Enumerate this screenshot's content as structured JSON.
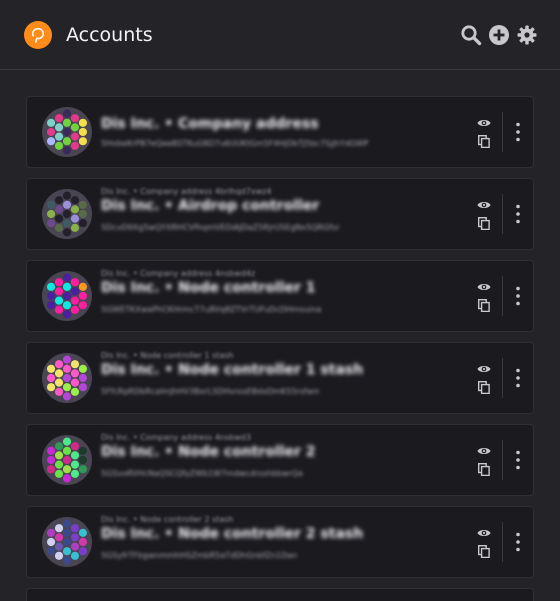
{
  "header": {
    "title": "Accounts",
    "logo_icon": "polkadot-logo",
    "actions": [
      "search-icon",
      "add-account-icon",
      "settings-icon"
    ]
  },
  "accounts": [
    {
      "parent": "",
      "name": "Dis Inc. • Company address",
      "address": "5HxbeKrPB7eQeeBSTKuG8D7u6UUKtGm5F4HjDbTJ5bc7SjjhYdGWP",
      "dots": [
        "#3a2a58",
        "#e23a8a",
        "#e23a8a",
        "#6fd23f",
        "#7fd0c8",
        "#f4df4a",
        "#7fd0c8",
        "#6fd23f",
        "#3a2a58",
        "#e23a8a",
        "#f4df4a",
        "#7fd0c8",
        "#e23a8a",
        "#6fd23f",
        "#a9b8ff",
        "#f4df4a",
        "#6fd23f",
        "#e23a8a",
        "#3a2a58"
      ]
    },
    {
      "parent": "Dis Inc. • Company address 4brlhqd7xwz4",
      "name": "Dis Inc. • Airdrop controller",
      "address": "5DcvD9Xg5wQYXRHCVfhqmVEDiAJDaZ5RjrU5EgNx5QRGfsr",
      "dots": [
        "#23202b",
        "#23202b",
        "#23202b",
        "#9a8fd8",
        "#3f5c64",
        "#5a6a48",
        "#6d4a8c",
        "#8ab04a",
        "#23202b",
        "#8ab04a",
        "#5a6a48",
        "#23202b",
        "#9a8fd8",
        "#3f5c64",
        "#6d4a8c",
        "#23202b",
        "#5a6a48",
        "#8ab04a",
        "#23202b"
      ]
    },
    {
      "parent": "Dis Inc. • Company address 4nsbwd4z",
      "name": "Dis Inc. • Node controller 1",
      "address": "5GWETKXwaPhCKHrmcT7u8Vq8ZTVrTUFuDcDHmsuina",
      "dots": [
        "#4a1fa0",
        "#ff1fa0",
        "#ff1fa0",
        "#13e8e0",
        "#13e8e0",
        "#ff9a1f",
        "#ff1fa0",
        "#4a1fa0",
        "#4a1fa0",
        "#4a1fa0",
        "#ff1fa0",
        "#13e8e0",
        "#ff1fa0",
        "#13e8e0",
        "#4a1fa0",
        "#ff1fa0",
        "#ff1fa0",
        "#ff1fa0",
        "#4a1fa0"
      ]
    },
    {
      "parent": "Dis Inc. • Node controller 1 stash",
      "name": "Dis Inc. • Node controller 1 stash",
      "address": "5FfcRpRDbRcalmJhHV3BxrL5DHvrxxEBdxDmK55rsfam",
      "dots": [
        "#b447d6",
        "#ff58c8",
        "#f4e36a",
        "#ff58c8",
        "#f4e36a",
        "#9aef4a",
        "#f4e36a",
        "#ff58c8",
        "#b447d6",
        "#ff58c8",
        "#b447d6",
        "#f4e36a",
        "#ff58c8",
        "#9aef4a",
        "#f4e36a",
        "#b447d6",
        "#ff58c8",
        "#9aef4a",
        "#b447d6"
      ]
    },
    {
      "parent": "Dis Inc. • Company address 4nsbwd3",
      "name": "Dis Inc. • Node controller 2",
      "address": "5GSvoRVHcNaQSCQfyZWb1W7mdwcdrsshbbwrQa",
      "dots": [
        "#4ce88a",
        "#2e9a55",
        "#d22a8c",
        "#6ae04a",
        "#c92ad6",
        "#1d3a2a",
        "#9de04a",
        "#4ce88a",
        "#d22a8c",
        "#c92ad6",
        "#1d3a2a",
        "#6ae04a",
        "#4ce88a",
        "#9de04a",
        "#d22a8c",
        "#2e9a55",
        "#6ae04a",
        "#4ce88a",
        "#c92ad6"
      ]
    },
    {
      "parent": "Dis Inc. • Node controller 2 stash",
      "name": "Dis Inc. • Node controller 2 stash",
      "address": "5GSyfrTFbgwnmmhHSZmbR5aTdDhGnbfZn1Dan",
      "dots": [
        "#3c4a8c",
        "#d0d0f0",
        "#7a3fc8",
        "#3c4a8c",
        "#b03ec0",
        "#38c0d0",
        "#d03aa8",
        "#7a3fc8",
        "#3c4a8c",
        "#d0d0f0",
        "#d03aa8",
        "#6b5ab0",
        "#b03ec0",
        "#38c0d0",
        "#3c4a8c",
        "#7a3fc8",
        "#d0d0f0",
        "#38c0d0",
        "#3c4a8c"
      ]
    }
  ]
}
